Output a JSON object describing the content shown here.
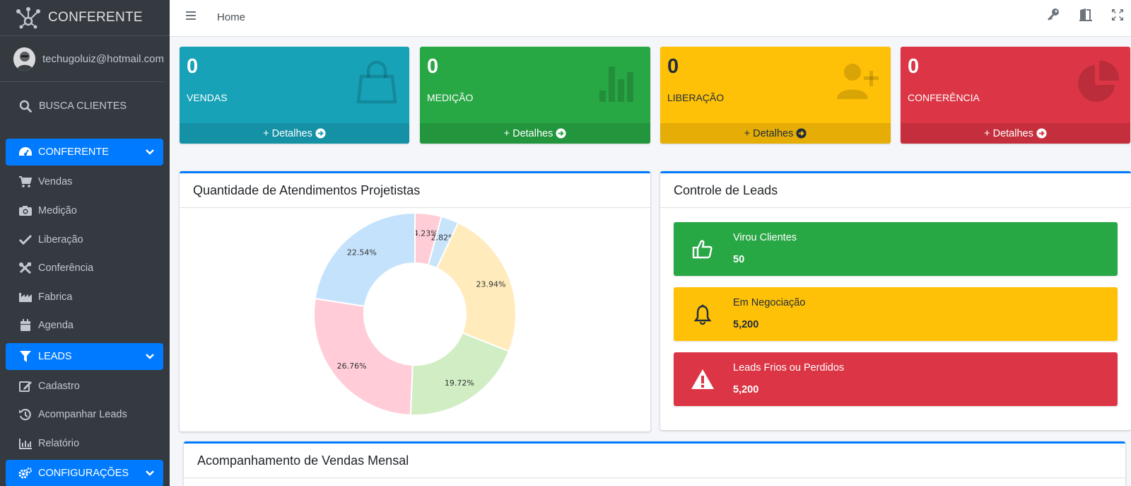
{
  "brand": {
    "name": "CONFERENTE"
  },
  "user": {
    "email": "techugoluiz@hotmail.com"
  },
  "sidebar": {
    "search_label": "BUSCA CLIENTES",
    "items": [
      {
        "label": "CONFERENTE",
        "icon": "tachometer-icon",
        "header": true
      },
      {
        "label": "Vendas",
        "icon": "cart-icon"
      },
      {
        "label": "Medição",
        "icon": "camera-icon"
      },
      {
        "label": "Liberação",
        "icon": "check-icon"
      },
      {
        "label": "Conferência",
        "icon": "tools-icon"
      },
      {
        "label": "Fabrica",
        "icon": "industry-icon"
      },
      {
        "label": "Agenda",
        "icon": "calendar-icon"
      },
      {
        "label": "LEADS",
        "icon": "filter-icon",
        "header": true
      },
      {
        "label": "Cadastro",
        "icon": "edit-icon"
      },
      {
        "label": "Acompanhar Leads",
        "icon": "history-icon"
      },
      {
        "label": "Relatório",
        "icon": "chart-icon"
      },
      {
        "label": "CONFIGURAÇÕES",
        "icon": "cogs-icon",
        "header": true
      }
    ]
  },
  "topbar": {
    "breadcrumb": "Home"
  },
  "boxes": [
    {
      "count": "0",
      "label": "VENDAS",
      "footer": "+ Detalhes",
      "color": "#17a2b8",
      "icon": "shopping-bag-icon"
    },
    {
      "count": "0",
      "label": "MEDIÇÃO",
      "footer": "+ Detalhes",
      "color": "#28a745",
      "icon": "bar-chart-icon"
    },
    {
      "count": "0",
      "label": "LIBERAÇÃO",
      "footer": "+ Detalhes",
      "color": "#ffc107",
      "icon": "user-plus-icon"
    },
    {
      "count": "0",
      "label": "CONFERÊNCIA",
      "footer": "+ Detalhes",
      "color": "#dc3545",
      "icon": "pie-chart-icon"
    }
  ],
  "pie_card": {
    "title": "Quantidade de Atendimentos Projetistas"
  },
  "leads_card": {
    "title": "Controle de Leads",
    "items": [
      {
        "label": "Virou Clientes",
        "value": "50",
        "color": "#28a745",
        "icon": "thumbs-up-icon"
      },
      {
        "label": "Em Negociação",
        "value": "5,200",
        "color": "#ffc107",
        "icon": "bell-icon"
      },
      {
        "label": "Leads Frios ou Perdidos",
        "value": "5,200",
        "color": "#dc3545",
        "icon": "warning-icon"
      }
    ]
  },
  "sales_card": {
    "title": "Acompanhamento de Vendas Mensal"
  },
  "chart_data": {
    "type": "pie",
    "variant": "doughnut",
    "values": [
      4.23,
      2.82,
      23.94,
      19.72,
      26.76,
      22.54
    ],
    "labels": [
      "4.23%",
      "2.82%",
      "23.94%",
      "19.72%",
      "26.76%",
      "22.54%"
    ],
    "colors": [
      "#ffcdd6",
      "#c7e4fb",
      "#ffebbc",
      "#d0edc4",
      "#ffccd7",
      "#c4e2fb"
    ]
  }
}
